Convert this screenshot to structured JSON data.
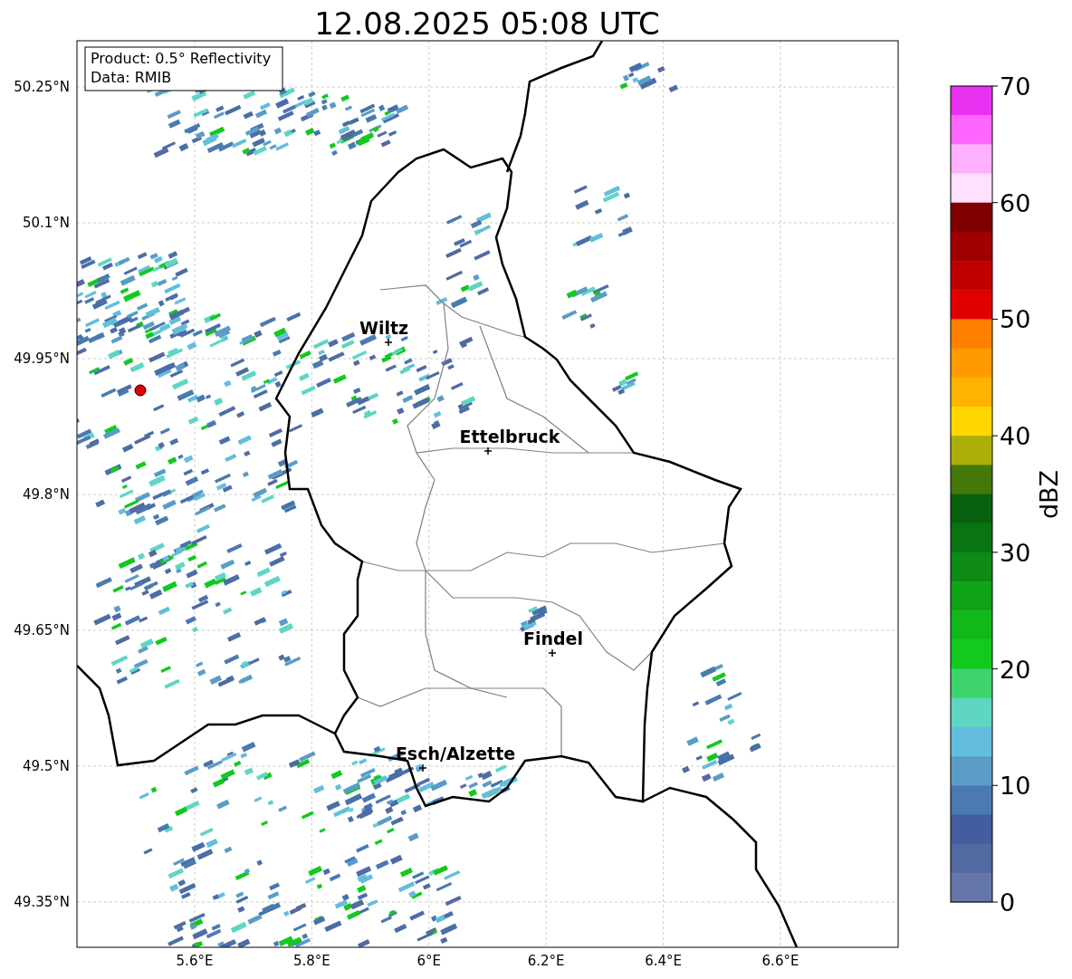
{
  "title": "12.08.2025 05:08 UTC",
  "info_box": {
    "lines": [
      "Product: 0.5° Reflectivity",
      "Data: RMIB"
    ]
  },
  "map": {
    "lat_ticks": [
      "50.25°N",
      "50.1°N",
      "49.95°N",
      "49.8°N",
      "49.65°N",
      "49.5°N",
      "49.35°N"
    ],
    "lon_ticks": [
      "5.6°E",
      "5.8°E",
      "6°E",
      "6.2°E",
      "6.4°E",
      "6.6°E"
    ],
    "cities": [
      {
        "name": "Wiltz"
      },
      {
        "name": "Ettelbruck"
      },
      {
        "name": "Findel"
      },
      {
        "name": "Esch/Alzette"
      }
    ]
  },
  "colorbar": {
    "label": "dBZ",
    "ticks": [
      "70",
      "60",
      "50",
      "40",
      "30",
      "20",
      "10",
      "0"
    ],
    "bins": [
      {
        "color": "#e830f0"
      },
      {
        "color": "#ff66ff"
      },
      {
        "color": "#ffb0ff"
      },
      {
        "color": "#ffe0ff"
      },
      {
        "color": "#800000"
      },
      {
        "color": "#a00000"
      },
      {
        "color": "#c00000"
      },
      {
        "color": "#e00000"
      },
      {
        "color": "#ff7f00"
      },
      {
        "color": "#ff9a00"
      },
      {
        "color": "#ffb300"
      },
      {
        "color": "#ffd700"
      },
      {
        "color": "#adaf08"
      },
      {
        "color": "#44780a"
      },
      {
        "color": "#08600f"
      },
      {
        "color": "#0a7412"
      },
      {
        "color": "#0e8a16"
      },
      {
        "color": "#10a318"
      },
      {
        "color": "#10b81a"
      },
      {
        "color": "#12c91e"
      },
      {
        "color": "#3dd46e"
      },
      {
        "color": "#5fd6c2"
      },
      {
        "color": "#63bedd"
      },
      {
        "color": "#5a9cc6"
      },
      {
        "color": "#4a7ab0"
      },
      {
        "color": "#445da0"
      },
      {
        "color": "#526aa0"
      },
      {
        "color": "#6577a8"
      }
    ]
  }
}
